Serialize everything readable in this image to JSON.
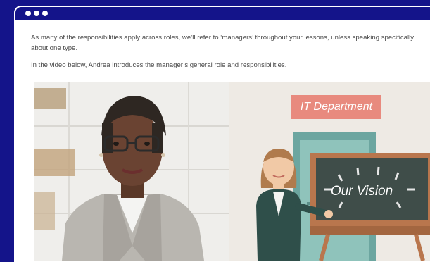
{
  "window": {
    "controls": [
      "dot",
      "dot",
      "dot"
    ]
  },
  "lesson": {
    "paragraphs": [
      "As many of the responsibilities apply across roles, we’ll refer to ‘managers’ throughout your lessons, unless speaking specifically about one type.",
      "In the video below, Andrea introduces the manager’s general role and responsibilities."
    ]
  },
  "video": {
    "department_sign": "IT Department",
    "board_text": "Our Vision"
  }
}
